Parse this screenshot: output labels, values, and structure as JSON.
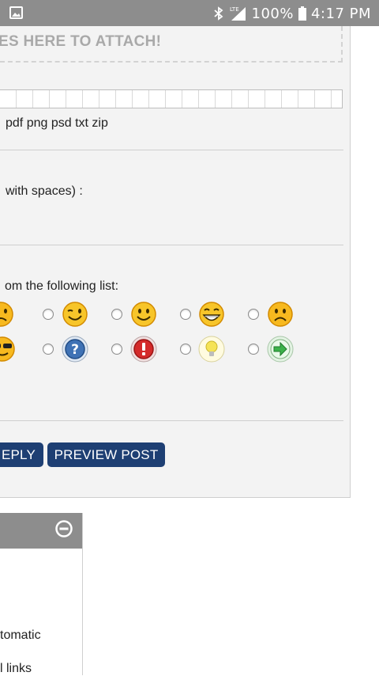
{
  "status_bar": {
    "battery": "100%",
    "time": "4:17 PM",
    "network": "LTE",
    "icons": [
      "image-icon",
      "bluetooth-icon",
      "lte-signal-icon",
      "battery-icon"
    ]
  },
  "attachments": {
    "drop_text": "ES HERE TO ATTACH!",
    "file_types": "pdf png psd txt zip"
  },
  "tags": {
    "hint": "with spaces) :"
  },
  "post_icons": {
    "label": "om the following list:",
    "row1": [
      "frown-smiley-icon",
      "wink-smiley-icon",
      "smile-smiley-icon",
      "grin-smiley-icon",
      "sad-smiley-icon"
    ],
    "row2": [
      "cool-smiley-icon",
      "question-icon",
      "exclamation-icon",
      "lightbulb-icon",
      "arrow-right-icon"
    ]
  },
  "buttons": {
    "reply": "EPLY",
    "preview": "PREVIEW POST"
  },
  "side_panel": {
    "line1": "tomatic",
    "line2": "l links"
  },
  "colors": {
    "status_bar": "#8d8d8d",
    "button": "#1e3f73",
    "panel": "#f3f3f3"
  }
}
